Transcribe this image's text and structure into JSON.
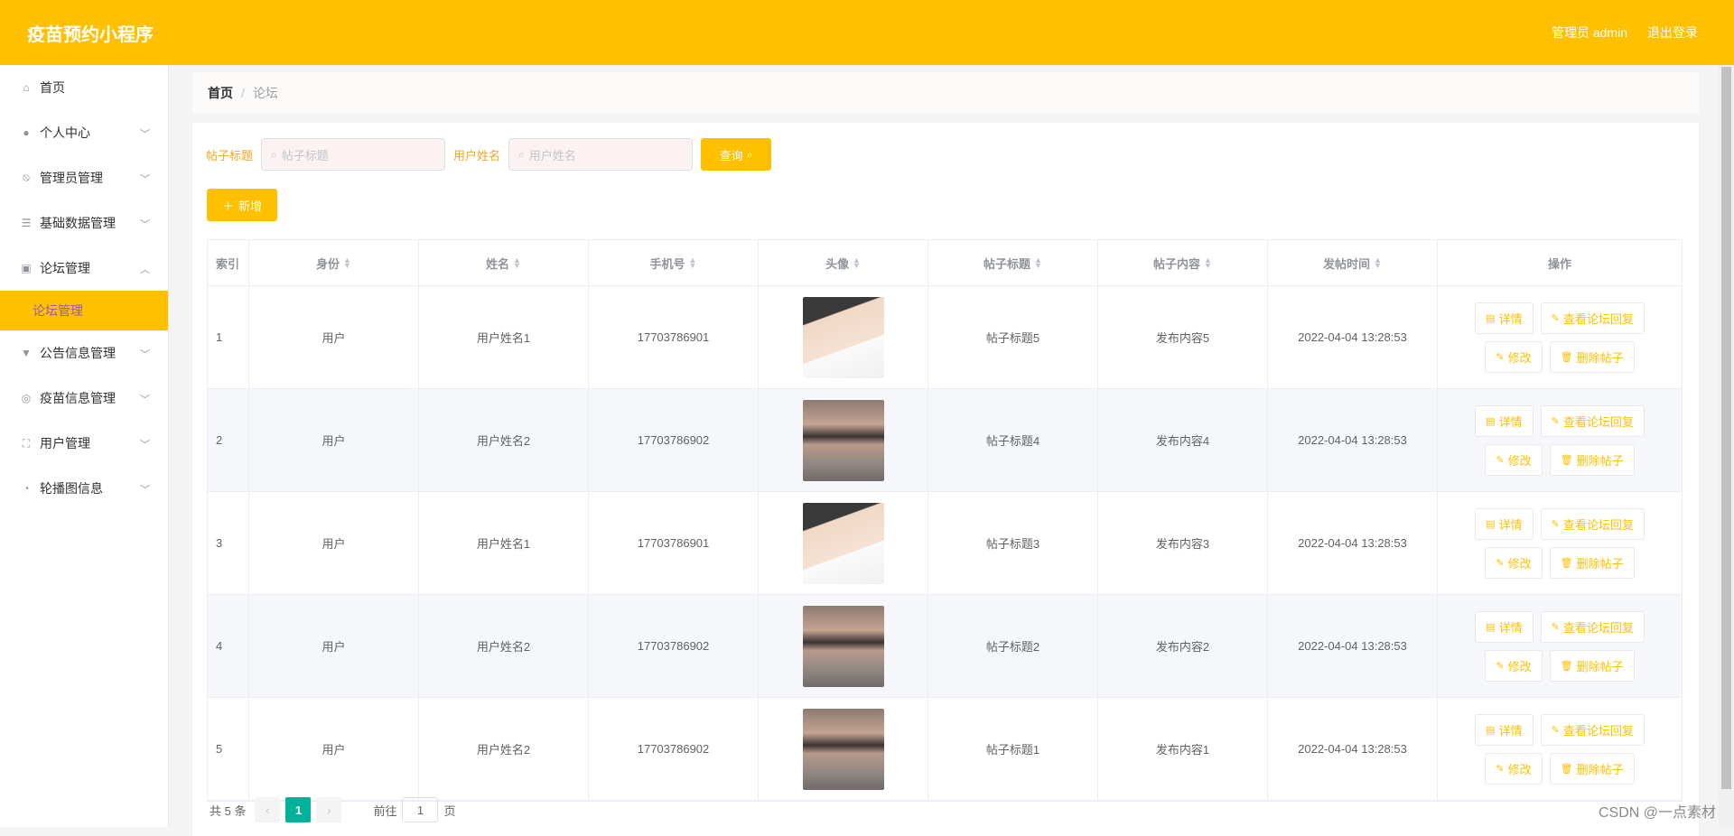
{
  "header": {
    "title": "疫苗预约小程序",
    "admin": "管理员 admin",
    "logout": "退出登录"
  },
  "sidebar": {
    "items": [
      {
        "label": "首页",
        "icon": "home-icon"
      },
      {
        "label": "个人中心",
        "icon": "user-icon"
      },
      {
        "label": "管理员管理",
        "icon": "bell-off-icon"
      },
      {
        "label": "基础数据管理",
        "icon": "sliders-icon"
      },
      {
        "label": "论坛管理",
        "icon": "clipboard-icon"
      },
      {
        "label": "公告信息管理",
        "icon": "cone-icon"
      },
      {
        "label": "疫苗信息管理",
        "icon": "compass-icon"
      },
      {
        "label": "用户管理",
        "icon": "fullscreen-icon"
      },
      {
        "label": "轮播图信息",
        "icon": "gauge-icon"
      }
    ],
    "submenu": {
      "label": "论坛管理"
    }
  },
  "breadcrumb": {
    "home": "首页",
    "sep": "/",
    "current": "论坛"
  },
  "filters": {
    "title_label": "帖子标题",
    "title_placeholder": "帖子标题",
    "user_label": "用户姓名",
    "user_placeholder": "用户姓名",
    "query": "查询"
  },
  "add_button": "新增",
  "table": {
    "headers": [
      "索引",
      "身份",
      "姓名",
      "手机号",
      "头像",
      "帖子标题",
      "帖子内容",
      "发帖时间",
      "操作"
    ],
    "rows": [
      {
        "idx": "1",
        "role": "用户",
        "name": "用户姓名1",
        "phone": "17703786901",
        "avatar": "a1",
        "title": "帖子标题5",
        "content": "发布内容5",
        "time": "2022-04-04 13:28:53"
      },
      {
        "idx": "2",
        "role": "用户",
        "name": "用户姓名2",
        "phone": "17703786902",
        "avatar": "a2",
        "title": "帖子标题4",
        "content": "发布内容4",
        "time": "2022-04-04 13:28:53"
      },
      {
        "idx": "3",
        "role": "用户",
        "name": "用户姓名1",
        "phone": "17703786901",
        "avatar": "a1",
        "title": "帖子标题3",
        "content": "发布内容3",
        "time": "2022-04-04 13:28:53"
      },
      {
        "idx": "4",
        "role": "用户",
        "name": "用户姓名2",
        "phone": "17703786902",
        "avatar": "a2",
        "title": "帖子标题2",
        "content": "发布内容2",
        "time": "2022-04-04 13:28:53"
      },
      {
        "idx": "5",
        "role": "用户",
        "name": "用户姓名2",
        "phone": "17703786902",
        "avatar": "a2",
        "title": "帖子标题1",
        "content": "发布内容1",
        "time": "2022-04-04 13:28:53"
      }
    ],
    "ops": {
      "detail": "详情",
      "reply": "查看论坛回复",
      "edit": "修改",
      "delete": "删除帖子"
    }
  },
  "pager": {
    "total": "共 5 条",
    "current": "1",
    "goto": "前往",
    "page_value": "1",
    "page_unit": "页"
  },
  "watermark": "CSDN @一点素材",
  "colors": {
    "accent": "#ffc000",
    "pager_active": "#00b29a"
  }
}
